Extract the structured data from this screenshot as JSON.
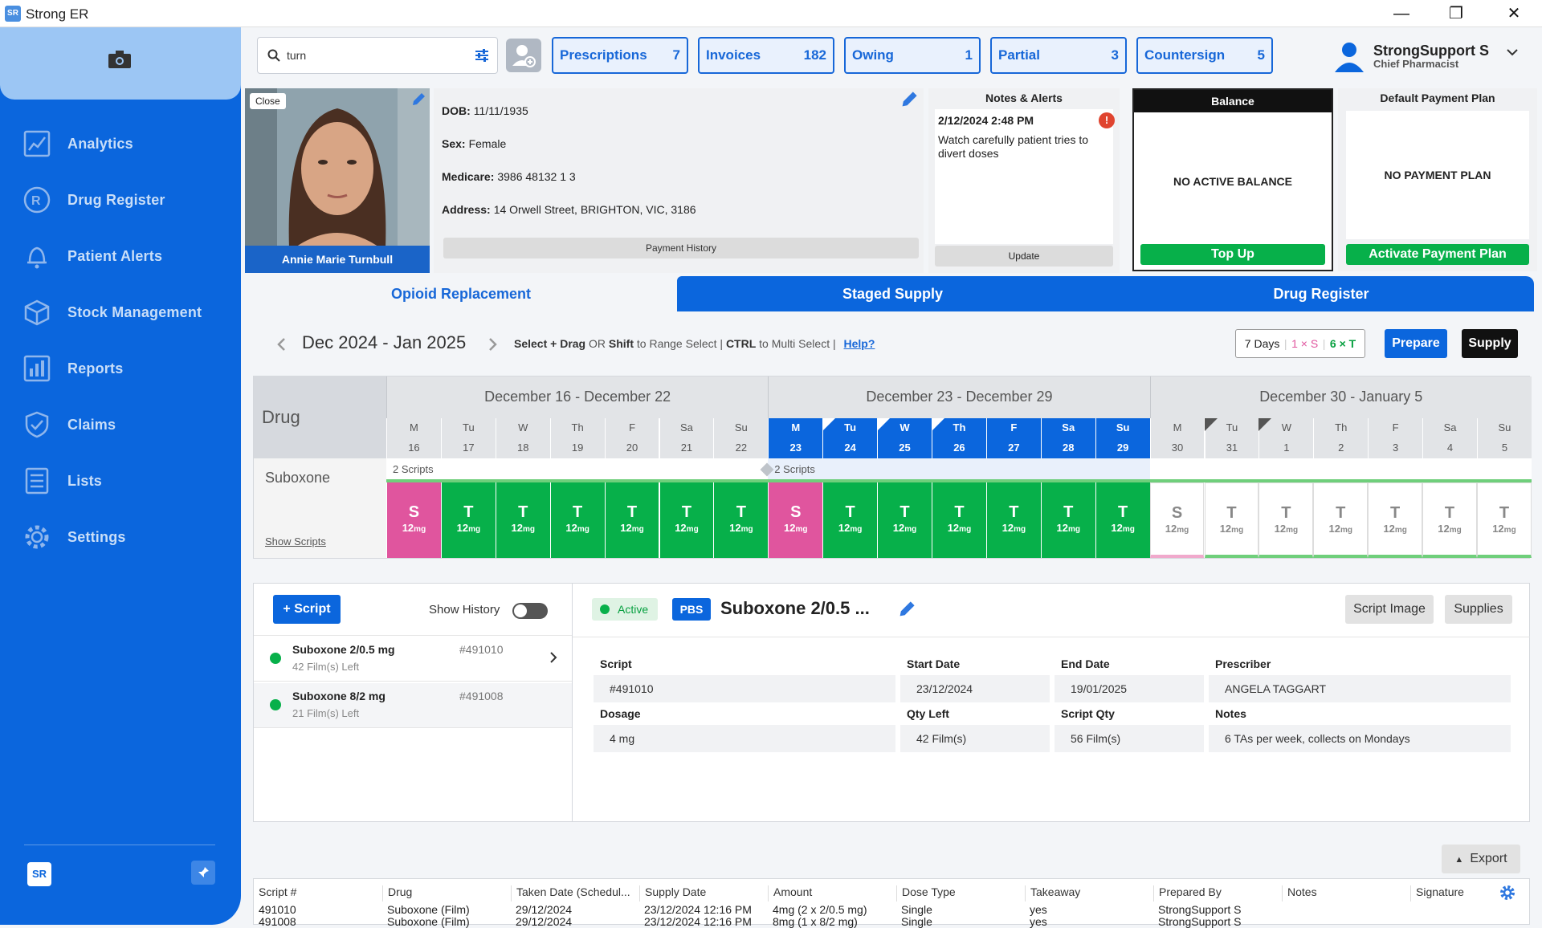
{
  "window": {
    "title": "Strong ER",
    "logo": "SR",
    "minimize": "—",
    "maximize": "❐",
    "close": "✕"
  },
  "sidebar": {
    "items": [
      {
        "label": "Analytics",
        "icon": "analytics-icon"
      },
      {
        "label": "Drug Register",
        "icon": "rx-icon"
      },
      {
        "label": "Patient Alerts",
        "icon": "bell-icon"
      },
      {
        "label": "Stock Management",
        "icon": "box-icon"
      },
      {
        "label": "Reports",
        "icon": "bar-chart-icon"
      },
      {
        "label": "Claims",
        "icon": "shield-check-icon"
      },
      {
        "label": "Lists",
        "icon": "list-icon"
      },
      {
        "label": "Settings",
        "icon": "gear-icon"
      }
    ],
    "logo": "SR",
    "pin": "📌"
  },
  "search": {
    "value": "turn"
  },
  "quick": [
    {
      "label": "Prescriptions",
      "count": "7"
    },
    {
      "label": "Invoices",
      "count": "182"
    },
    {
      "label": "Owing",
      "count": "1"
    },
    {
      "label": "Partial",
      "count": "3"
    },
    {
      "label": "Countersign",
      "count": "5"
    }
  ],
  "user": {
    "name": "StrongSupport S",
    "role": "Chief Pharmacist"
  },
  "patient": {
    "close": "Close",
    "name": "Annie Marie Turnbull",
    "dob_label": "DOB:",
    "dob": "11/11/1935",
    "sex_label": "Sex:",
    "sex": "Female",
    "medicare_label": "Medicare:",
    "medicare": "3986 48132 1 3",
    "address_label": "Address:",
    "address": "14 Orwell Street, BRIGHTON, VIC, 3186",
    "payment_history": "Payment History"
  },
  "notes": {
    "title": "Notes & Alerts",
    "date": "2/12/2024 2:48 PM",
    "alert": "!",
    "text": "Watch carefully patient tries to divert doses",
    "update": "Update"
  },
  "balance": {
    "title": "Balance",
    "status": "NO ACTIVE BALANCE",
    "button": "Top Up"
  },
  "payplan": {
    "title": "Default Payment Plan",
    "status": "NO PAYMENT PLAN",
    "button": "Activate Payment Plan"
  },
  "tabs": [
    "Opioid Replacement",
    "Staged Supply",
    "Drug Register"
  ],
  "calendar": {
    "range": "Dec 2024 - Jan 2025",
    "hint_1": "Select + Drag",
    "hint_2": " OR ",
    "hint_3": "Shift",
    "hint_4": " to Range Select | ",
    "hint_5": "CTRL",
    "hint_6": " to Multi Select | ",
    "help": "Help?",
    "days_count": "7",
    "days_word": "Days",
    "s_count": "1 × S",
    "t_count": "6 × T",
    "prepare": "Prepare",
    "supply": "Supply",
    "drug_header": "Drug",
    "drug": "Suboxone",
    "show_scripts": "Show Scripts",
    "weeks": [
      "December 16 - December 22",
      "December 23 - December 29",
      "December 30 - January 5"
    ],
    "daynames": [
      "M",
      "Tu",
      "W",
      "Th",
      "F",
      "Sa",
      "Su",
      "M",
      "Tu",
      "W",
      "Th",
      "F",
      "Sa",
      "Su",
      "M",
      "Tu",
      "W",
      "Th",
      "F",
      "Sa",
      "Su"
    ],
    "daynums": [
      "16",
      "17",
      "18",
      "19",
      "20",
      "21",
      "22",
      "23",
      "24",
      "25",
      "26",
      "27",
      "28",
      "29",
      "30",
      "31",
      "1",
      "2",
      "3",
      "4",
      "5"
    ],
    "scripts_label_1": "2 Scripts",
    "scripts_label_2": "2 Scripts",
    "cells": [
      "S",
      "T",
      "T",
      "T",
      "T",
      "T",
      "T",
      "S",
      "T",
      "T",
      "T",
      "T",
      "T",
      "T",
      "S",
      "T",
      "T",
      "T",
      "T",
      "T",
      "T"
    ],
    "dose": "12",
    "unit": "mg"
  },
  "scripts": {
    "add": "+ Script",
    "show_history": "Show History",
    "list": [
      {
        "name": "Suboxone 2/0.5 mg",
        "id": "#491010",
        "left": "42 Film(s) Left"
      },
      {
        "name": "Suboxone 8/2 mg",
        "id": "#491008",
        "left": "21 Film(s) Left"
      }
    ]
  },
  "detail": {
    "active": "Active",
    "pbs": "PBS",
    "title": "Suboxone 2/0.5 ...",
    "script_image": "Script Image",
    "supplies": "Supplies",
    "script_label": "Script",
    "script": "#491010",
    "start_label": "Start Date",
    "start": "23/12/2024",
    "end_label": "End Date",
    "end": "19/01/2025",
    "prescriber_label": "Prescriber",
    "prescriber": "ANGELA TAGGART",
    "dosage_label": "Dosage",
    "dosage": "4 mg",
    "qty_left_label": "Qty Left",
    "qty_left": "42 Film(s)",
    "script_qty_label": "Script Qty",
    "script_qty": "56 Film(s)",
    "notes_label": "Notes",
    "notes": "6 TAs per week, collects on Mondays"
  },
  "export": "Export",
  "table": {
    "headers": [
      "Script #",
      "Drug",
      "Taken Date (Schedul...",
      "Supply Date",
      "Amount",
      "Dose Type",
      "Takeaway",
      "Prepared By",
      "Notes",
      "Signature"
    ],
    "rows": [
      [
        "491010",
        "Suboxone (Film)",
        "29/12/2024",
        "23/12/2024 12:16 PM",
        "4mg (2 x 2/0.5 mg)",
        "Single",
        "yes",
        "StrongSupport S",
        "",
        ""
      ],
      [
        "491008",
        "Suboxone (Film)",
        "29/12/2024",
        "23/12/2024 12:16 PM",
        "8mg (1 x 8/2 mg)",
        "Single",
        "yes",
        "StrongSupport S",
        "",
        ""
      ]
    ]
  }
}
